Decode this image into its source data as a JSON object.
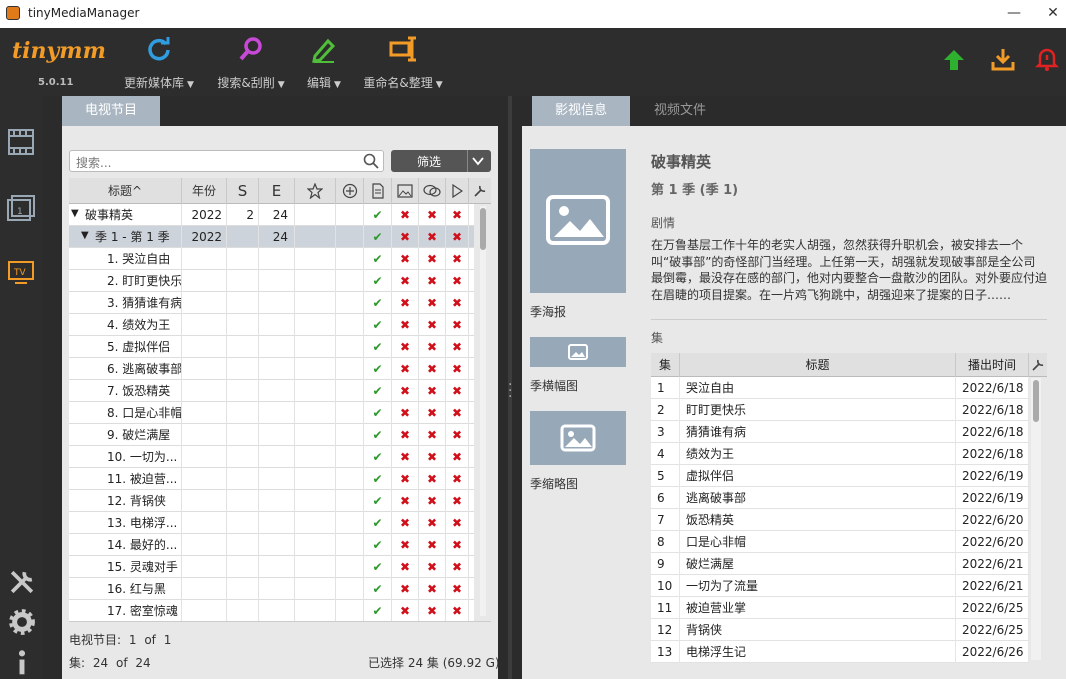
{
  "window": {
    "title": "tinyMediaManager",
    "minimize": "—",
    "maximize": "☐",
    "close": "✕"
  },
  "toolbar": {
    "logo": "tinymm",
    "version": "5.0.11",
    "buttons": [
      {
        "label": "更新媒体库",
        "icon": "refresh-icon",
        "color": "#2f9de0"
      },
      {
        "label": "搜索&刮削",
        "icon": "search-icon",
        "color": "#c64ad6"
      },
      {
        "label": "编辑",
        "icon": "edit-pencil-icon",
        "color": "#4fbf3a"
      },
      {
        "label": "重命名&整理",
        "icon": "rename-icon",
        "color": "#f29b27"
      }
    ],
    "right_icons": [
      {
        "icon": "upgrade-arrow-icon",
        "color": "#2fb12f"
      },
      {
        "icon": "download-icon",
        "color": "#f29b27"
      },
      {
        "icon": "notification-bell-icon",
        "color": "#e02222"
      }
    ]
  },
  "sidebar": {
    "items": [
      {
        "icon": "movies-film-icon"
      },
      {
        "icon": "movie-sets-icon"
      },
      {
        "icon": "tv-shows-icon",
        "label": "TV"
      }
    ],
    "bottom": [
      {
        "icon": "tools-icon"
      },
      {
        "icon": "settings-gear-icon"
      },
      {
        "icon": "info-icon"
      }
    ]
  },
  "left": {
    "tab": "电视节目",
    "search_placeholder": "搜索...",
    "filter": "筛选",
    "columns": {
      "title": "标题",
      "sort_mark": "^",
      "year": "年份",
      "s": "S",
      "e": "E"
    },
    "show": {
      "title": "破事精英",
      "year": "2022",
      "s": "2",
      "e": "24"
    },
    "season": {
      "title": "季 1 - 第 1 季",
      "year": "2022",
      "e": "24"
    },
    "episodes": [
      "1. 哭泣自由",
      "2. 盯盯更快乐",
      "3. 猜猜谁有病",
      "4. 绩效为王",
      "5. 虚拟伴侣",
      "6. 逃离破事部",
      "7. 饭恐精英",
      "8. 口是心非帽",
      "9. 破烂满屋",
      "10. 一切为...",
      "11. 被迫营...",
      "12. 背锅侠",
      "13. 电梯浮...",
      "14. 最好的...",
      "15. 灵魂对手",
      "16. 红与黑",
      "17. 密室惊魂"
    ],
    "status_shows_label": "电视节目:",
    "status_shows_value": "1",
    "status_of": "of",
    "status_shows_total": "1",
    "status_eps_label": "集:",
    "status_eps_value": "24",
    "status_eps_total": "24",
    "status_selected": "已选择 24 集 (69.92 G)"
  },
  "right": {
    "tabs": [
      "影视信息",
      "视频文件"
    ],
    "show_title": "破事精英",
    "season_title": "第 1 季 (季 1)",
    "plot_label": "剧情",
    "plot": "在万鲁基层工作十年的老实人胡强，忽然获得升职机会，被安排去一个叫“破事部”的奇怪部门当经理。上任第一天，胡强就发现破事部是全公司最倒霉，最没存在感的部门，他对内要整合一盘散沙的团队。对外要应付迫在眉睫的项目提案。在一片鸡飞狗跳中，胡强迎来了提案的日子……",
    "poster_label": "季海报",
    "banner_label": "季横幅图",
    "thumb_label": "季缩略图",
    "episodes_label": "集",
    "ep_columns": {
      "num": "集",
      "title": "标题",
      "aired": "播出时间"
    },
    "episodes": [
      {
        "num": "1",
        "title": "哭泣自由",
        "aired": "2022/6/18"
      },
      {
        "num": "2",
        "title": "盯盯更快乐",
        "aired": "2022/6/18"
      },
      {
        "num": "3",
        "title": "猜猜谁有病",
        "aired": "2022/6/18"
      },
      {
        "num": "4",
        "title": "绩效为王",
        "aired": "2022/6/18"
      },
      {
        "num": "5",
        "title": "虚拟伴侣",
        "aired": "2022/6/19"
      },
      {
        "num": "6",
        "title": "逃离破事部",
        "aired": "2022/6/19"
      },
      {
        "num": "7",
        "title": "饭恐精英",
        "aired": "2022/6/20"
      },
      {
        "num": "8",
        "title": "口是心非帽",
        "aired": "2022/6/20"
      },
      {
        "num": "9",
        "title": "破烂满屋",
        "aired": "2022/6/21"
      },
      {
        "num": "10",
        "title": "一切为了流量",
        "aired": "2022/6/21"
      },
      {
        "num": "11",
        "title": "被迫营业掌",
        "aired": "2022/6/25"
      },
      {
        "num": "12",
        "title": "背锅侠",
        "aired": "2022/6/25"
      },
      {
        "num": "13",
        "title": "电梯浮生记",
        "aired": "2022/6/26"
      }
    ]
  }
}
